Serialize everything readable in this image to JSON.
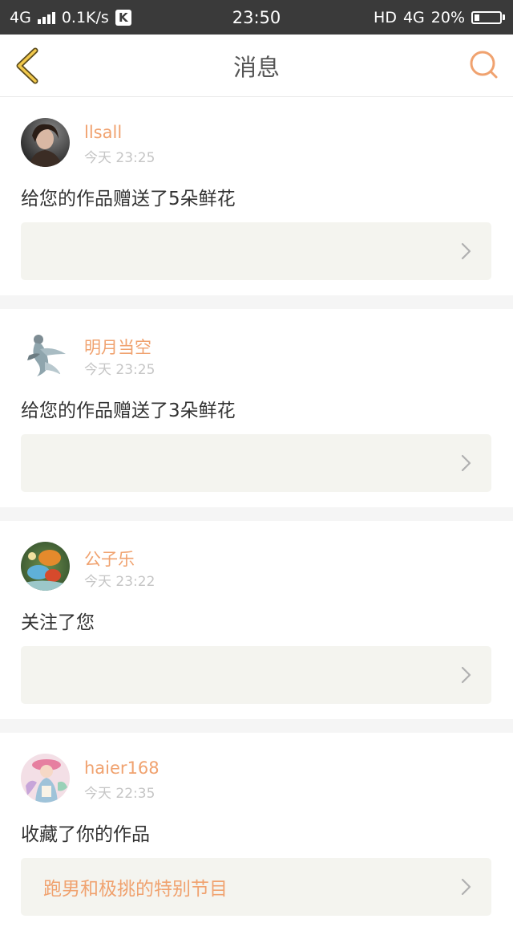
{
  "status_bar": {
    "network": "4G",
    "speed": "0.1K/s",
    "k_badge": "K",
    "time": "23:50",
    "hd": "HD",
    "network2": "4G",
    "battery_percent": "20%",
    "battery_level": 0.2
  },
  "nav": {
    "title": "消息",
    "back_icon": "back-chevron-icon",
    "search_icon": "search-icon",
    "accent_color": "#f0a26f"
  },
  "messages": [
    {
      "username": "llsall",
      "time": "今天 23:25",
      "action": "给您的作品赠送了5朵鲜花",
      "link_text": ""
    },
    {
      "username": "明月当空",
      "time": "今天 23:25",
      "action": "给您的作品赠送了3朵鲜花",
      "link_text": ""
    },
    {
      "username": "公子乐",
      "time": "今天 23:22",
      "action": "关注了您",
      "link_text": ""
    },
    {
      "username": "haier168",
      "time": "今天 22:35",
      "action": "收藏了你的作品",
      "link_text": "跑男和极挑的特别节目"
    }
  ]
}
